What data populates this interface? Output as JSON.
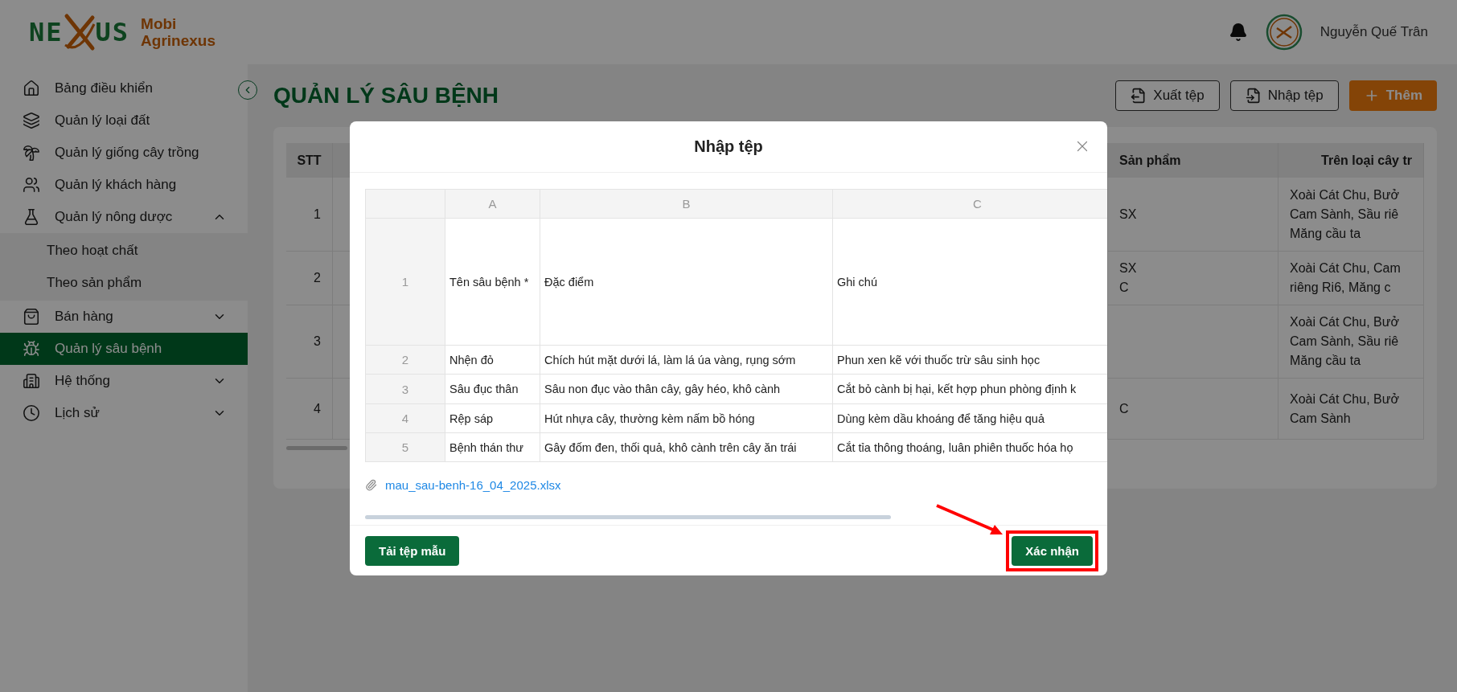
{
  "logo": {
    "mark_left": "NE",
    "mark_right": "US",
    "name_lines": [
      "Mobi",
      "Agrinexus"
    ]
  },
  "user": {
    "name": "Nguyễn Quế Trân"
  },
  "sidebar": {
    "items": [
      {
        "label": "Bảng điều khiển",
        "selected": false
      },
      {
        "label": "Quản lý loại đất",
        "selected": false
      },
      {
        "label": "Quản lý giống cây trồng",
        "selected": false
      },
      {
        "label": "Quản lý khách hàng",
        "selected": false
      },
      {
        "label": "Quản lý nông dược",
        "selected": false,
        "expanded": true,
        "children": [
          {
            "label": "Theo hoạt chất",
            "selected": false
          },
          {
            "label": "Theo sản phẩm",
            "selected": false
          }
        ]
      },
      {
        "label": "Bán hàng",
        "selected": false,
        "expanded": false
      },
      {
        "label": "Quản lý sâu bệnh",
        "selected": true
      },
      {
        "label": "Hệ thống",
        "selected": false,
        "expanded": false
      },
      {
        "label": "Lịch sử",
        "selected": false,
        "expanded": false
      }
    ]
  },
  "page_title": "QUẢN LÝ SÂU BỆNH",
  "actions": [
    {
      "kind": "export",
      "label": "Xuất tệp"
    },
    {
      "kind": "import",
      "label": "Nhập tệp"
    },
    {
      "kind": "add",
      "label": "Thêm"
    }
  ],
  "table": {
    "columns": [
      {
        "label": "STT"
      },
      {
        "label": "Sản phẩm"
      },
      {
        "label": "Trên loại cây tr"
      }
    ],
    "rows": [
      {
        "stt": "1",
        "column_2": [
          "SX"
        ],
        "crops": [
          "Xoài Cát Chu, Bưở",
          "Cam Sành, Sầu riê",
          "Măng cầu ta"
        ]
      },
      {
        "stt": "2",
        "column_2": [
          "SX",
          "C"
        ],
        "crops": [
          "Xoài Cát Chu, Cam",
          "riêng Ri6, Măng c"
        ]
      },
      {
        "stt": "3",
        "column_2": [],
        "crops": [
          "Xoài Cát Chu, Bưở",
          "Cam Sành, Sầu riê",
          "Măng cầu ta"
        ]
      },
      {
        "stt": "4",
        "column_2": [
          "C"
        ],
        "crops": [
          "Xoài Cát Chu, Bưở",
          "Cam Sành"
        ]
      }
    ]
  },
  "modal": {
    "title": "Nhập tệp",
    "sheet": {
      "columns": [
        "A",
        "B",
        "C"
      ],
      "rows": [
        {
          "number": "1",
          "cells": [
            "Tên sâu bệnh *",
            "Đặc điểm",
            "Ghi chú"
          ]
        },
        {
          "number": "2",
          "cells": [
            "Nhện đỏ",
            "Chích hút mặt dưới lá, làm lá úa vàng, rụng sớm",
            "Phun xen kẽ với thuốc trừ sâu sinh học"
          ]
        },
        {
          "number": "3",
          "cells": [
            "Sâu đục thân",
            "Sâu non đục vào thân cây, gây héo, khô cành",
            "Cắt bỏ cành bị hại, kết hợp phun phòng định k"
          ]
        },
        {
          "number": "4",
          "cells": [
            "Rệp sáp",
            "Hút nhựa cây, thường kèm nấm bồ hóng",
            "Dùng kèm dầu khoáng để tăng hiệu quả"
          ]
        },
        {
          "number": "5",
          "cells": [
            "Bệnh thán thư",
            "Gây đốm đen, thối quả, khô cành trên cây ăn trái",
            "Cắt tỉa thông thoáng, luân phiên thuốc hóa họ"
          ]
        }
      ]
    },
    "file_name": "mau_sau-benh-16_04_2025.xlsx",
    "download_label": "Tải tệp mẫu",
    "confirm_label": "Xác nhận"
  }
}
